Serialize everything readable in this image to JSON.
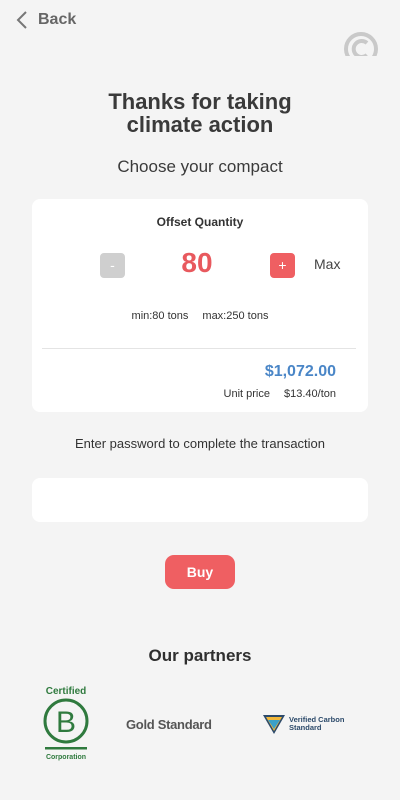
{
  "nav": {
    "back_label": "Back",
    "back_icon": "chevron-left-icon",
    "logo_icon": "c-logo-icon"
  },
  "header": {
    "title_line1": "Thanks for taking",
    "title_line2": "climate action",
    "subtitle": "Choose your compact"
  },
  "offset": {
    "label": "Offset Quantity",
    "minus_label": "-",
    "quantity": "80",
    "plus_label": "+",
    "max_label": "Max",
    "min_text": "min:80 tons",
    "max_text": "max:250 tons",
    "total": "$1,072.00",
    "unit_price_label": "Unit price",
    "unit_price_value": "$13.40/ton"
  },
  "transaction": {
    "prompt": "Enter password to complete the transaction",
    "password_value": "",
    "buy_label": "Buy"
  },
  "partners": {
    "title": "Our partners",
    "bcorp": {
      "top": "Certified",
      "letter": "B",
      "bottom": "Corporation"
    },
    "gold_standard": "Gold Standard",
    "vcs": {
      "line1": "Verified Carbon",
      "line2": "Standard"
    }
  },
  "colors": {
    "accent": "#ef5f62",
    "price_blue": "#4a86c7",
    "bcorp_green": "#2f7a3e",
    "background": "#f4f4f4"
  }
}
